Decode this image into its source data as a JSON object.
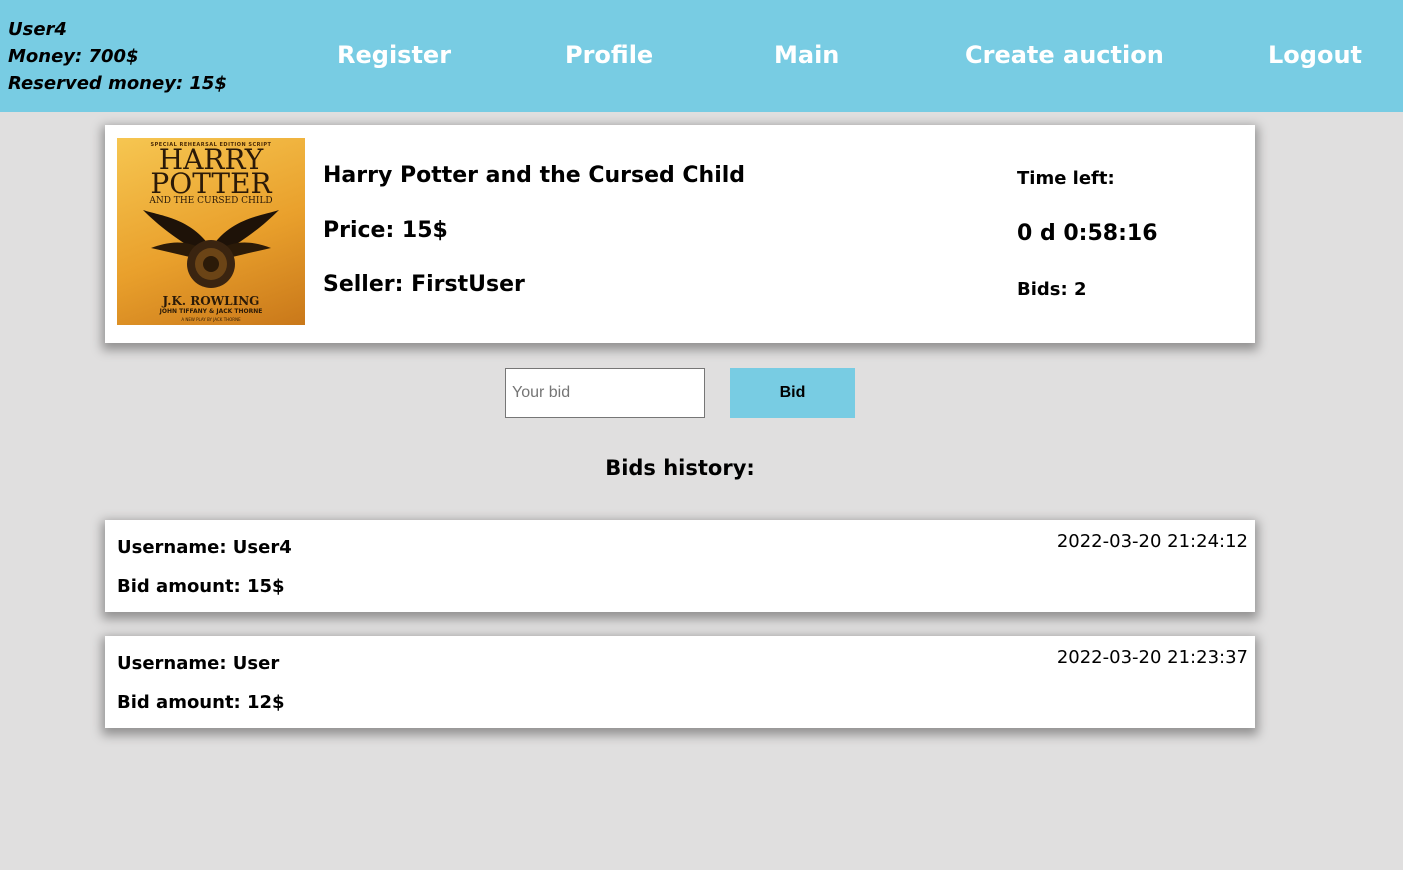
{
  "user": {
    "username": "User4",
    "money": "Money: 700$",
    "reserved": "Reserved money: 15$"
  },
  "nav": {
    "register": "Register",
    "profile": "Profile",
    "main": "Main",
    "create_auction": "Create auction",
    "logout": "Logout"
  },
  "auction": {
    "title": "Harry Potter and the Cursed Child",
    "price": "Price: 15$",
    "seller": "Seller: FirstUser",
    "time_left_label": "Time left:",
    "time_left": "0 d 0:58:16",
    "bids": "Bids: 2",
    "cover": {
      "tagline": "SPECIAL REHEARSAL EDITION SCRIPT",
      "series": "HARRY POTTER",
      "subtitle": "AND THE CURSED CHILD",
      "author": "J.K. ROWLING",
      "coauthors": "JOHN TIFFANY & JACK THORNE",
      "footnote": "A NEW PLAY BY JACK THORNE"
    }
  },
  "bid_form": {
    "placeholder": "Your bid",
    "button": "Bid"
  },
  "history": {
    "title": "Bids history:",
    "entries": [
      {
        "username": "Username: User4",
        "amount": "Bid amount: 15$",
        "time": "2022-03-20 21:24:12"
      },
      {
        "username": "Username: User",
        "amount": "Bid amount: 12$",
        "time": "2022-03-20 21:23:37"
      }
    ]
  },
  "colors": {
    "accent": "#78cce3",
    "background": "#e0dfdf",
    "card": "#ffffff"
  }
}
